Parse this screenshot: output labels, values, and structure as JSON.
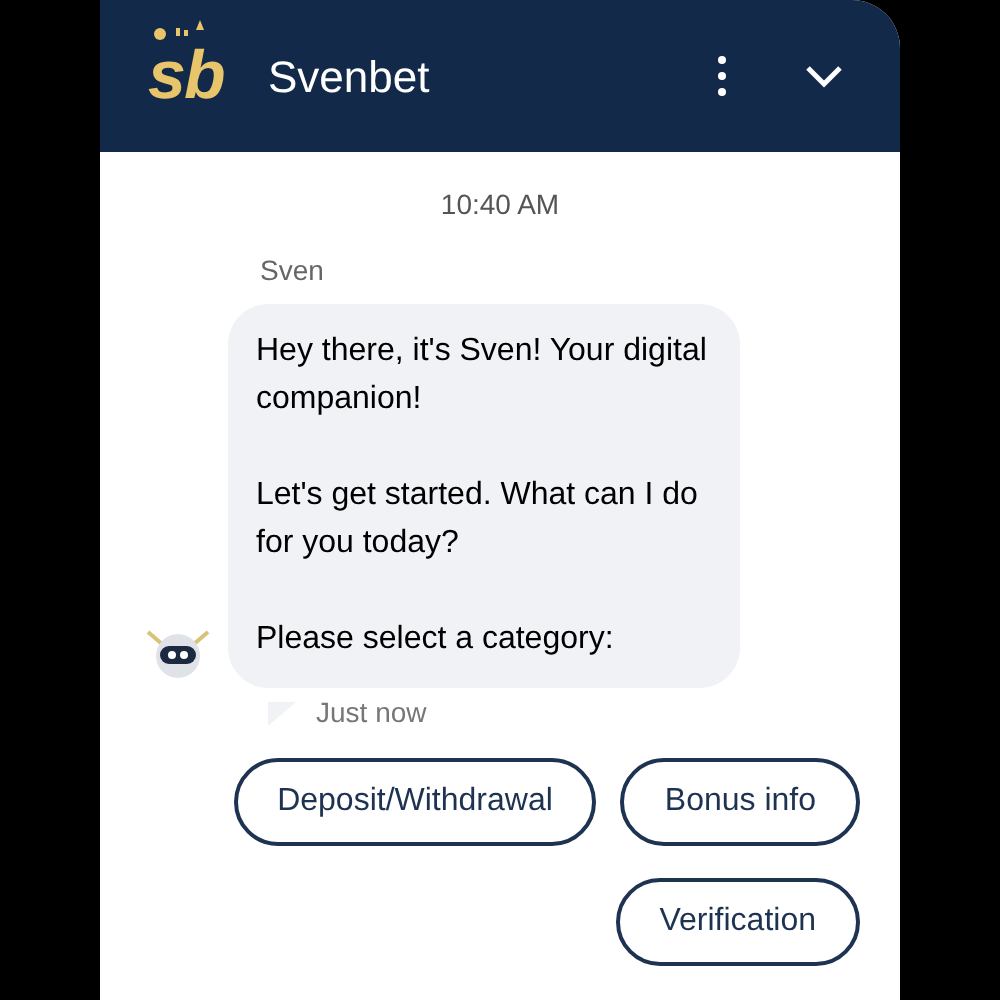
{
  "header": {
    "logo": "sb",
    "title": "Svenbet"
  },
  "timestamp": "10:40 AM",
  "message": {
    "sender": "Sven",
    "paragraphs": [
      "Hey there, it's Sven! Your digital companion!",
      "Let's get started. What can I do for you today?",
      "Please select a category:"
    ],
    "time": "Just now"
  },
  "quick_replies": [
    [
      "Deposit/Withdrawal",
      "Bonus info"
    ],
    [
      "Verification"
    ]
  ]
}
